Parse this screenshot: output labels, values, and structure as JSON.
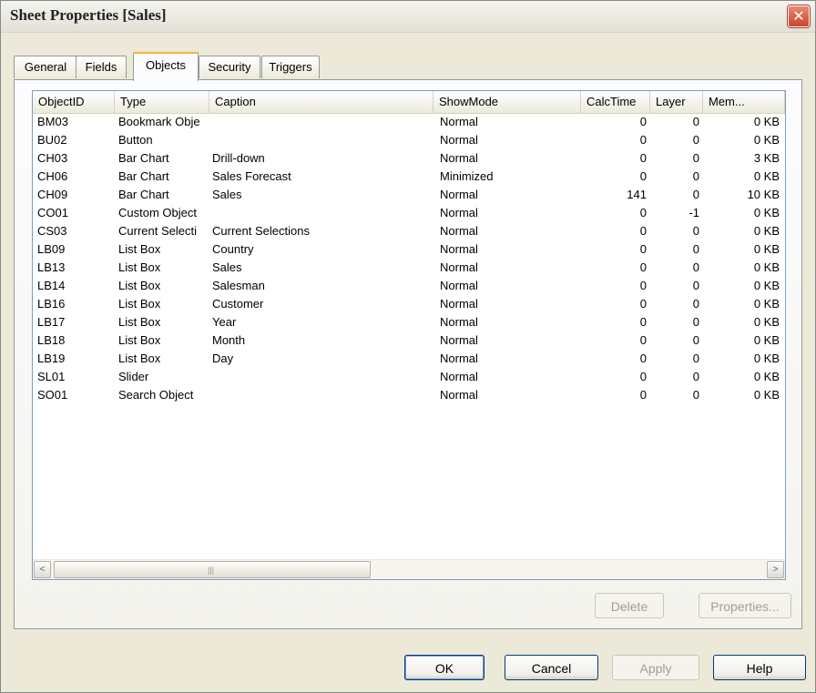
{
  "window": {
    "title": "Sheet Properties [Sales]",
    "close_glyph": "✕"
  },
  "tabs": [
    {
      "label": "General"
    },
    {
      "label": "Fields"
    },
    {
      "label": "Objects"
    },
    {
      "label": "Security"
    },
    {
      "label": "Triggers"
    }
  ],
  "active_tab": "Objects",
  "objects_table": {
    "columns": [
      "ObjectID",
      "Type",
      "Caption",
      "ShowMode",
      "CalcTime",
      "Layer",
      "Mem..."
    ],
    "rows": [
      [
        "BM03",
        "Bookmark Obje",
        "",
        "Normal",
        "0",
        "0",
        "0 KB"
      ],
      [
        "BU02",
        "Button",
        "",
        "Normal",
        "0",
        "0",
        "0 KB"
      ],
      [
        "CH03",
        "Bar Chart",
        "Drill-down",
        "Normal",
        "0",
        "0",
        "3 KB"
      ],
      [
        "CH06",
        "Bar Chart",
        "Sales Forecast",
        "Minimized",
        "0",
        "0",
        "0 KB"
      ],
      [
        "CH09",
        "Bar Chart",
        "Sales",
        "Normal",
        "141",
        "0",
        "10 KB"
      ],
      [
        "CO01",
        "Custom Object",
        "",
        "Normal",
        "0",
        "-1",
        "0 KB"
      ],
      [
        "CS03",
        "Current Selecti",
        "Current Selections",
        "Normal",
        "0",
        "0",
        "0 KB"
      ],
      [
        "LB09",
        "List Box",
        "Country",
        "Normal",
        "0",
        "0",
        "0 KB"
      ],
      [
        "LB13",
        "List Box",
        "Sales",
        "Normal",
        "0",
        "0",
        "0 KB"
      ],
      [
        "LB14",
        "List Box",
        "Salesman",
        "Normal",
        "0",
        "0",
        "0 KB"
      ],
      [
        "LB16",
        "List Box",
        "Customer",
        "Normal",
        "0",
        "0",
        "0 KB"
      ],
      [
        "LB17",
        "List Box",
        "Year",
        "Normal",
        "0",
        "0",
        "0 KB"
      ],
      [
        "LB18",
        "List Box",
        "Month",
        "Normal",
        "0",
        "0",
        "0 KB"
      ],
      [
        "LB19",
        "List Box",
        "Day",
        "Normal",
        "0",
        "0",
        "0 KB"
      ],
      [
        "SL01",
        "Slider",
        "",
        "Normal",
        "0",
        "0",
        "0 KB"
      ],
      [
        "SO01",
        "Search Object",
        "",
        "Normal",
        "0",
        "0",
        "0 KB"
      ]
    ]
  },
  "scrollbar": {
    "left_arrow": "<",
    "right_arrow": ">",
    "grip": "|||"
  },
  "panel_buttons": {
    "delete": "Delete",
    "properties": "Properties..."
  },
  "dialog_buttons": {
    "ok": "OK",
    "cancel": "Cancel",
    "apply": "Apply",
    "help": "Help"
  }
}
